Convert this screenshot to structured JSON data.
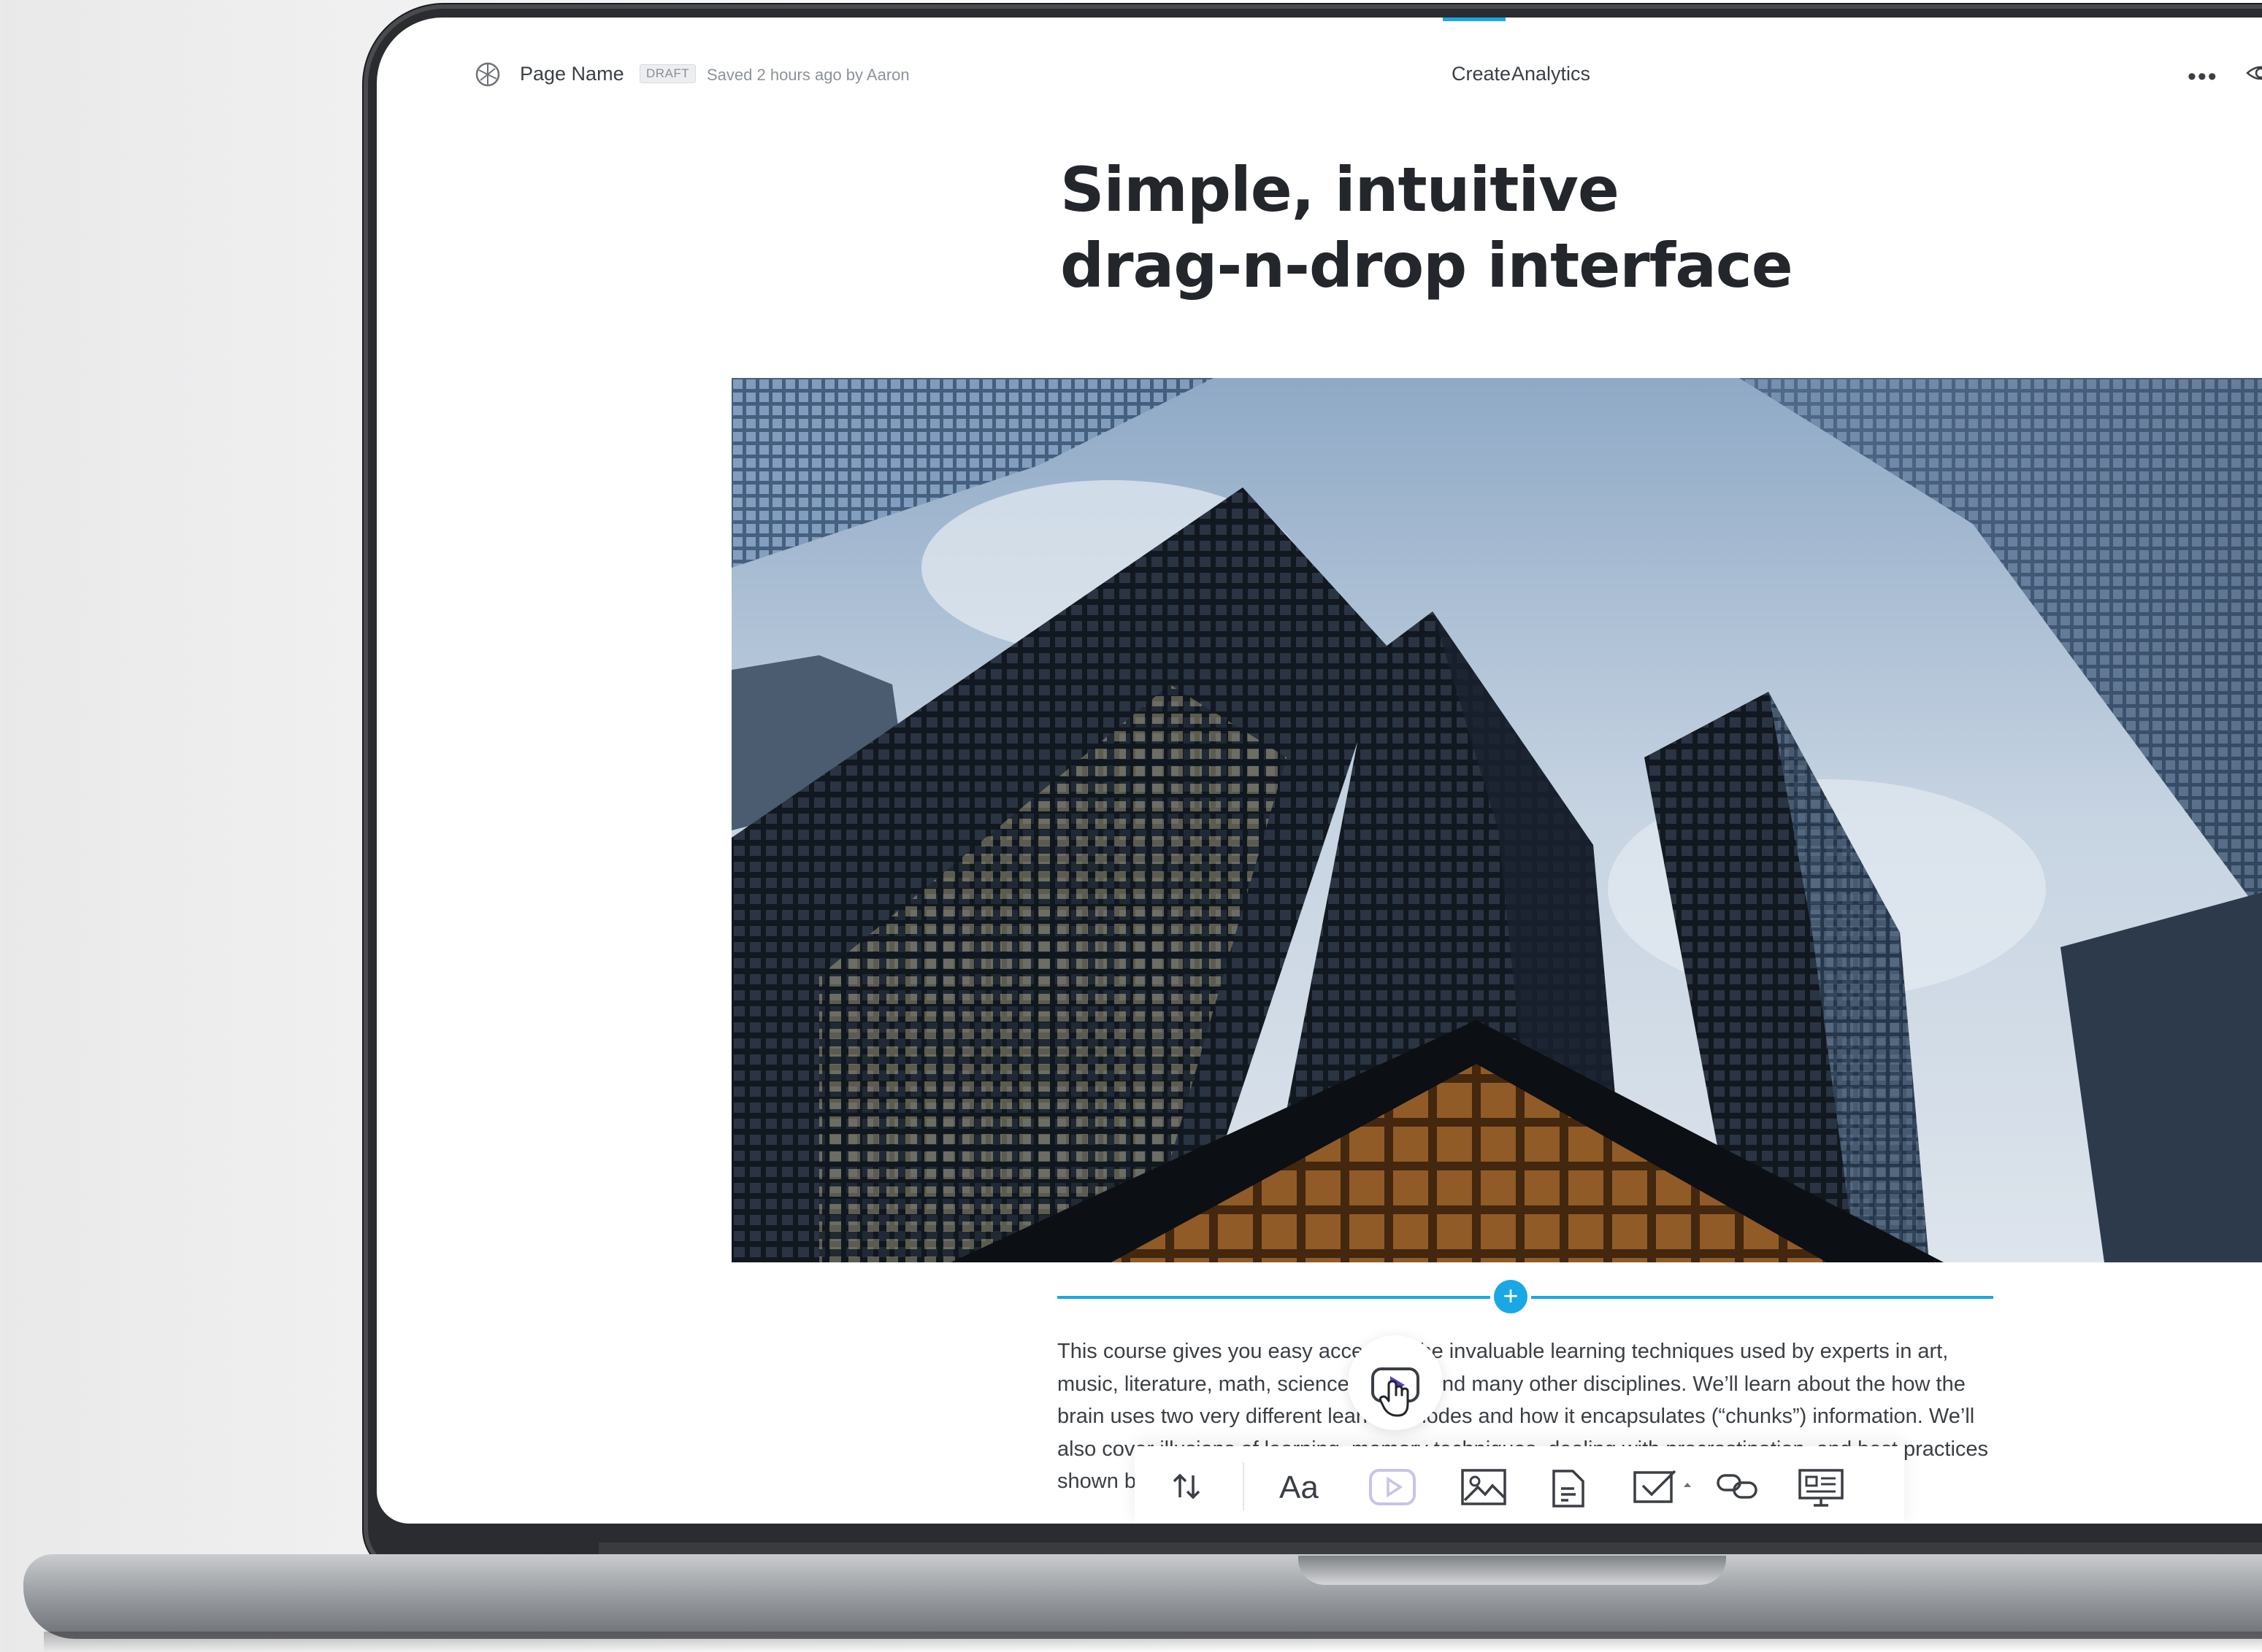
{
  "topbar": {
    "page_name": "Page Name",
    "draft_badge": "DRAFT",
    "saved_status": "Saved 2 hours ago by Aaron",
    "tabs": [
      {
        "label": "Create",
        "active": true
      },
      {
        "label": "Analytics",
        "active": false
      }
    ],
    "more_icon": "more-icon",
    "preview_icon": "eye-icon"
  },
  "content": {
    "heading_line1": "Simple, intuitive",
    "heading_line2": "drag-n-drop interface",
    "hero_image": "city-skyscrapers-photo",
    "body_text": "This course gives you easy access to the invaluable learning techniques used by experts in art, music, literature, math, science, sports, and many other disciplines. We’ll learn about the how the brain uses two very different learning modes and how it encapsulates (“chunks”) information. We’ll also cover illusions of learning, memory techniques, dealing with procrastination, and best practices shown by research to be most effective in helping you master tough subjects."
  },
  "toolbar": {
    "items": [
      {
        "icon": "reorder-icon"
      },
      {
        "icon": "text-icon",
        "label": "Aa"
      },
      {
        "icon": "video-icon"
      },
      {
        "icon": "image-icon"
      },
      {
        "icon": "document-icon"
      },
      {
        "icon": "quiz-icon"
      },
      {
        "icon": "link-icon"
      },
      {
        "icon": "presentation-icon"
      }
    ]
  },
  "colors": {
    "accent": "#1aa7e6",
    "text": "#3b3f45",
    "heading": "#23262b",
    "video_accent": "#5b3fc7"
  }
}
